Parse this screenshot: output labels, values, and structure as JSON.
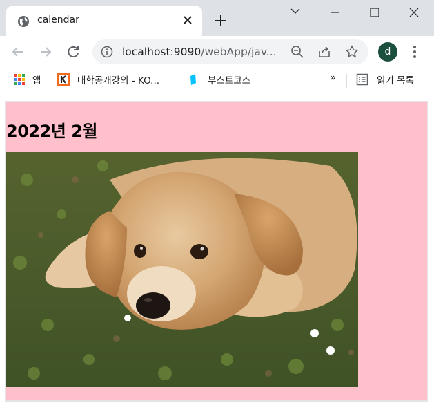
{
  "tab": {
    "title": "calendar"
  },
  "address_bar": {
    "host": "localhost:9090",
    "path": "/webApp/jav..."
  },
  "profile": {
    "initial": "d"
  },
  "bookmarks": {
    "apps_label": "앱",
    "item1_label": "대학공개강의 - KO...",
    "item2_label": "부스트코스",
    "overflow_label": "»",
    "reading_list_label": "읽기 목록"
  },
  "page": {
    "heading": "2022년 2월",
    "background_color": "#ffc0cb",
    "image_subject": "golden-retriever-puppy-lying-on-grass"
  },
  "colors": {
    "tabstrip": "#dee1e6",
    "avatar": "#1b4f3e",
    "page_bg": "#ffc0cb"
  }
}
